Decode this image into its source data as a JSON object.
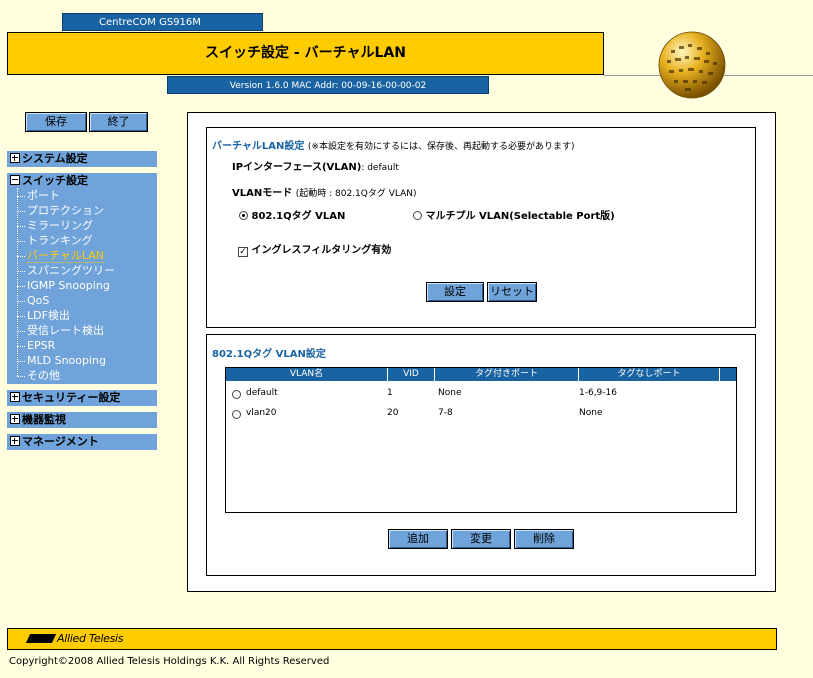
{
  "header": {
    "model": "CentreCOM GS916M",
    "title": "スイッチ設定 - バーチャルLAN",
    "version": "Version 1.6.0 MAC Addr: 00-09-16-00-00-02"
  },
  "buttons": {
    "save": "保存",
    "exit": "終了"
  },
  "sidebar": {
    "system": "システム設定",
    "switch": "スイッチ設定",
    "switch_items": [
      "ポート",
      "プロテクション",
      "ミラーリング",
      "トランキング",
      "バーチャルLAN",
      "スパニングツリー",
      "IGMP Snooping",
      "QoS",
      "LDF検出",
      "受信レート検出",
      "EPSR",
      "MLD Snooping",
      "その他"
    ],
    "security": "セキュリティー設定",
    "monitor": "機器監視",
    "management": "マネージメント"
  },
  "vlan_settings": {
    "title": "バーチャルLAN設定",
    "note": "(※本設定を有効にするには、保存後、再起動する必要があります)",
    "ip_interface_label": "IPインターフェース(VLAN)",
    "ip_interface_value": ": default",
    "vlan_mode_label": "VLANモード",
    "vlan_mode_note": "(起動時 : 802.1Qタグ VLAN)",
    "mode_option_1": "802.1Qタグ VLAN",
    "mode_option_2": "マルチプル VLAN(Selectable Port版)",
    "ingress_filter_label": "イングレスフィルタリング有効",
    "set_button": "設定",
    "reset_button": "リセット"
  },
  "qtag": {
    "title": "802.1Qタグ VLAN設定",
    "columns": [
      "VLAN名",
      "VID",
      "タグ付きポート",
      "タグなしポート"
    ],
    "rows": [
      {
        "name": "default",
        "vid": "1",
        "tagged": "None",
        "untagged": "1-6,9-16"
      },
      {
        "name": "vlan20",
        "vid": "20",
        "tagged": "7-8",
        "untagged": "None"
      }
    ],
    "add_button": "追加",
    "edit_button": "変更",
    "delete_button": "削除"
  },
  "footer": {
    "logo": "Allied Telesis",
    "copyright": "Copyright©2008 Allied Telesis Holdings K.K. All Rights Reserved"
  },
  "colors": {
    "accent_blue": "#1a63a3",
    "menu_blue": "#6fa3d9",
    "brand_yellow": "#ffcc00",
    "page_bg": "#ffffe0"
  }
}
